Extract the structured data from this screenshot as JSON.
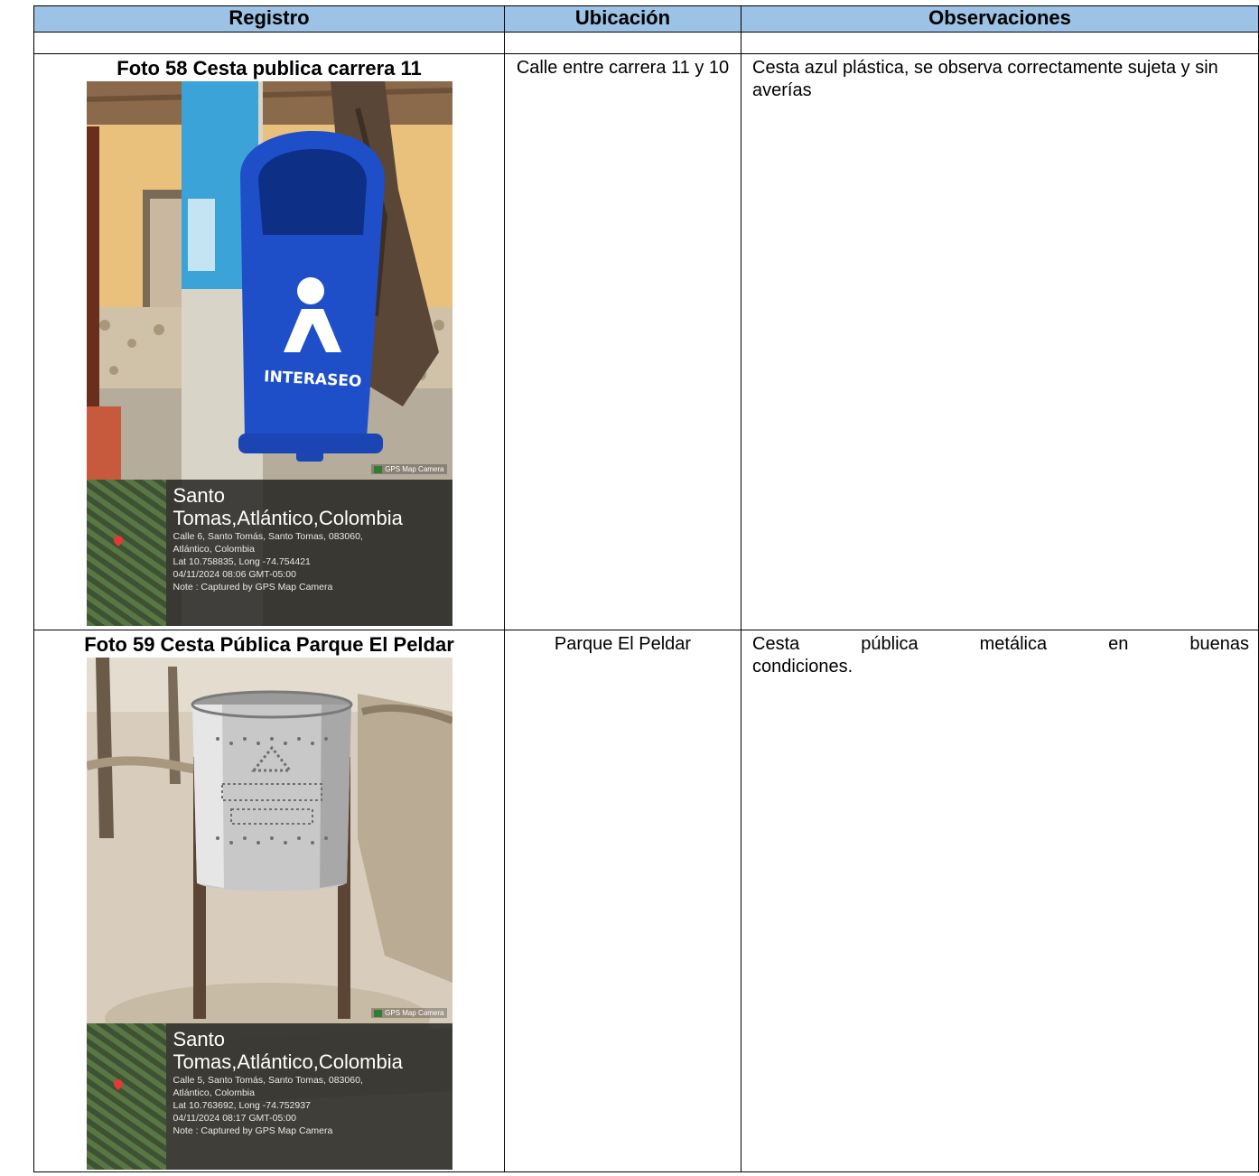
{
  "table": {
    "headers": [
      "Registro",
      "Ubicación",
      "Observaciones"
    ]
  },
  "records": [
    {
      "caption": "Foto 58 Cesta publica carrera 11",
      "ubicacion": "Calle entre carrera 11 y 10",
      "observaciones": "Cesta azul plástica, se observa correctamente sujeta y sin averías",
      "photo": {
        "badge": "GPS Map Camera",
        "logo_text": "INTERASEO",
        "place_line1": "Santo",
        "place_line2": "Tomas,Atlántico,Colombia",
        "address": "Calle 6, Santo Tomás, Santo Tomas, 083060,",
        "address2": "Atlántico, Colombia",
        "coords": "Lat 10.758835, Long -74.754421",
        "datetime": "04/11/2024 08:06 GMT-05:00",
        "note": "Note : Captured by GPS Map Camera"
      }
    },
    {
      "caption": "Foto 59 Cesta Pública Parque El Peldar",
      "ubicacion": "Parque El Peldar",
      "observaciones": "Cesta pública metálica en buenas condiciones.",
      "observaciones_row1": "Cesta pública metálica en buenas",
      "observaciones_row2": "condiciones.",
      "photo": {
        "badge": "GPS Map Camera",
        "place_line1": "Santo",
        "place_line2": "Tomas,Atlántico,Colombia",
        "address": "Calle 5, Santo Tomás, Santo Tomas, 083060,",
        "address2": "Atlántico, Colombia",
        "coords": "Lat 10.763692, Long -74.752937",
        "datetime": "04/11/2024 08:17 GMT-05:00",
        "note": "Note : Captured by GPS Map Camera"
      }
    }
  ],
  "colors": {
    "header_bg": "#9cc2e5",
    "bin_blue": "#1e4fc9"
  }
}
